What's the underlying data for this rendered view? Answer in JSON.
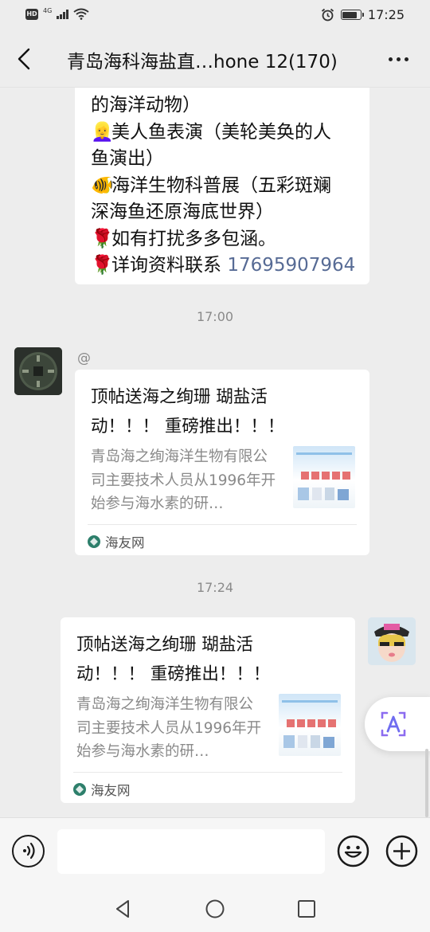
{
  "status_bar": {
    "hd_label": "HD",
    "network": "4G",
    "time": "17:25",
    "battery_level": 0.82
  },
  "header": {
    "title": "青岛海科海盐直…hone 12(170)"
  },
  "messages": {
    "prev_text": {
      "lines": [
        {
          "emoji": "",
          "text": "的海洋动物）"
        },
        {
          "emoji": "👱‍♀️",
          "text": "美人鱼表演（美轮美奂的人"
        },
        {
          "emoji": "",
          "text": "鱼演出）"
        },
        {
          "emoji": "🐠",
          "text": "海洋生物科普展（五彩斑斓"
        },
        {
          "emoji": "",
          "text": "深海鱼还原海底世界）"
        },
        {
          "emoji": "🌹",
          "text": "如有打扰多多包涵。"
        },
        {
          "emoji": "🌹",
          "text": "详询资料联系 "
        }
      ],
      "phone": "17695907964"
    },
    "timestamp_1": "17:00",
    "sender_nick": "@",
    "card_1": {
      "title": "顶帖送海之绚珊 瑚盐活动！！！ 重磅推出！！！",
      "desc": "青岛海之绚海洋生物有限公司主要技术人员从1996年开始参与海水素的研…",
      "source": "海友网"
    },
    "timestamp_2": "17:24",
    "card_2": {
      "title": "顶帖送海之绚珊 瑚盐活动！！！ 重磅推出！！！",
      "desc": "青岛海之绚海洋生物有限公司主要技术人员从1996年开始参与海水素的研…",
      "source": "海友网"
    }
  },
  "input": {
    "placeholder": ""
  },
  "colors": {
    "background": "#ededed",
    "bubble": "#ffffff",
    "link": "#576b95",
    "muted": "#8a8a8a",
    "float_accent": "#8c6cf0"
  }
}
